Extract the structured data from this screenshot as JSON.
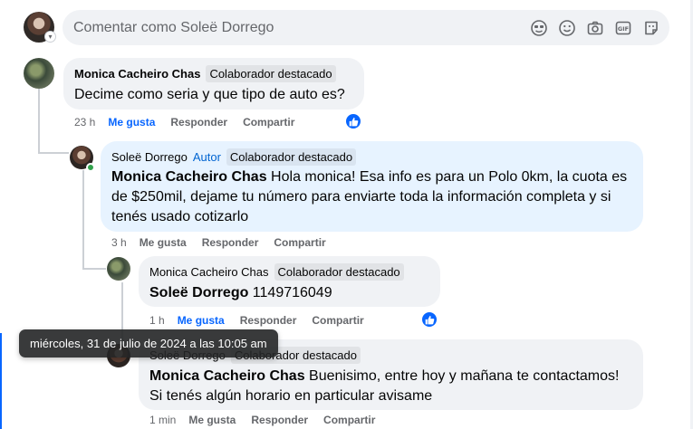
{
  "composer": {
    "placeholder": "Comentar como Soleë Dorrego",
    "icons": [
      "sticker-face-icon",
      "emoji-icon",
      "camera-icon",
      "gif-icon",
      "sticker-icon"
    ]
  },
  "comments": [
    {
      "author": "Monica Cacheiro Chas",
      "badge": "Colaborador destacado",
      "text": "Decime como seria y que tipo de auto es?",
      "time": "23 h",
      "like": "Me gusta",
      "reply": "Responder",
      "share": "Compartir"
    },
    {
      "author": "Soleë Dorrego",
      "author_tag": "Autor",
      "badge": "Colaborador destacado",
      "mention": "Monica Cacheiro Chas",
      "text_line1": " Hola monica! Esa info es para un Polo 0km, la cuota es",
      "text_line2": "de $250mil, dejame tu número para enviarte toda la información completa y si",
      "text_line3": "tenés usado cotizarlo",
      "time": "3 h",
      "like": "Me gusta",
      "reply": "Responder",
      "share": "Compartir"
    },
    {
      "author": "Monica Cacheiro Chas",
      "badge": "Colaborador destacado",
      "mention": "Soleë Dorrego",
      "text": " 1149716049",
      "time": "1 h",
      "like": "Me gusta",
      "reply": "Responder",
      "share": "Compartir"
    },
    {
      "author": "Soleë Dorrego",
      "badge": "Colaborador destacado",
      "mention": "Monica Cacheiro Chas",
      "text_line1": " Buenisimo, entre hoy y mañana te contactamos!",
      "text_line2": "Si tenés algún horario en particular avisame",
      "time": "1 min",
      "like": "Me gusta",
      "reply": "Responder",
      "share": "Compartir"
    }
  ],
  "tooltip": "miércoles, 31 de julio de 2024 a las 10:05 am",
  "colors": {
    "accent": "#0866ff",
    "author_bubble": "#e7f3ff",
    "bubble": "#f0f2f5"
  }
}
